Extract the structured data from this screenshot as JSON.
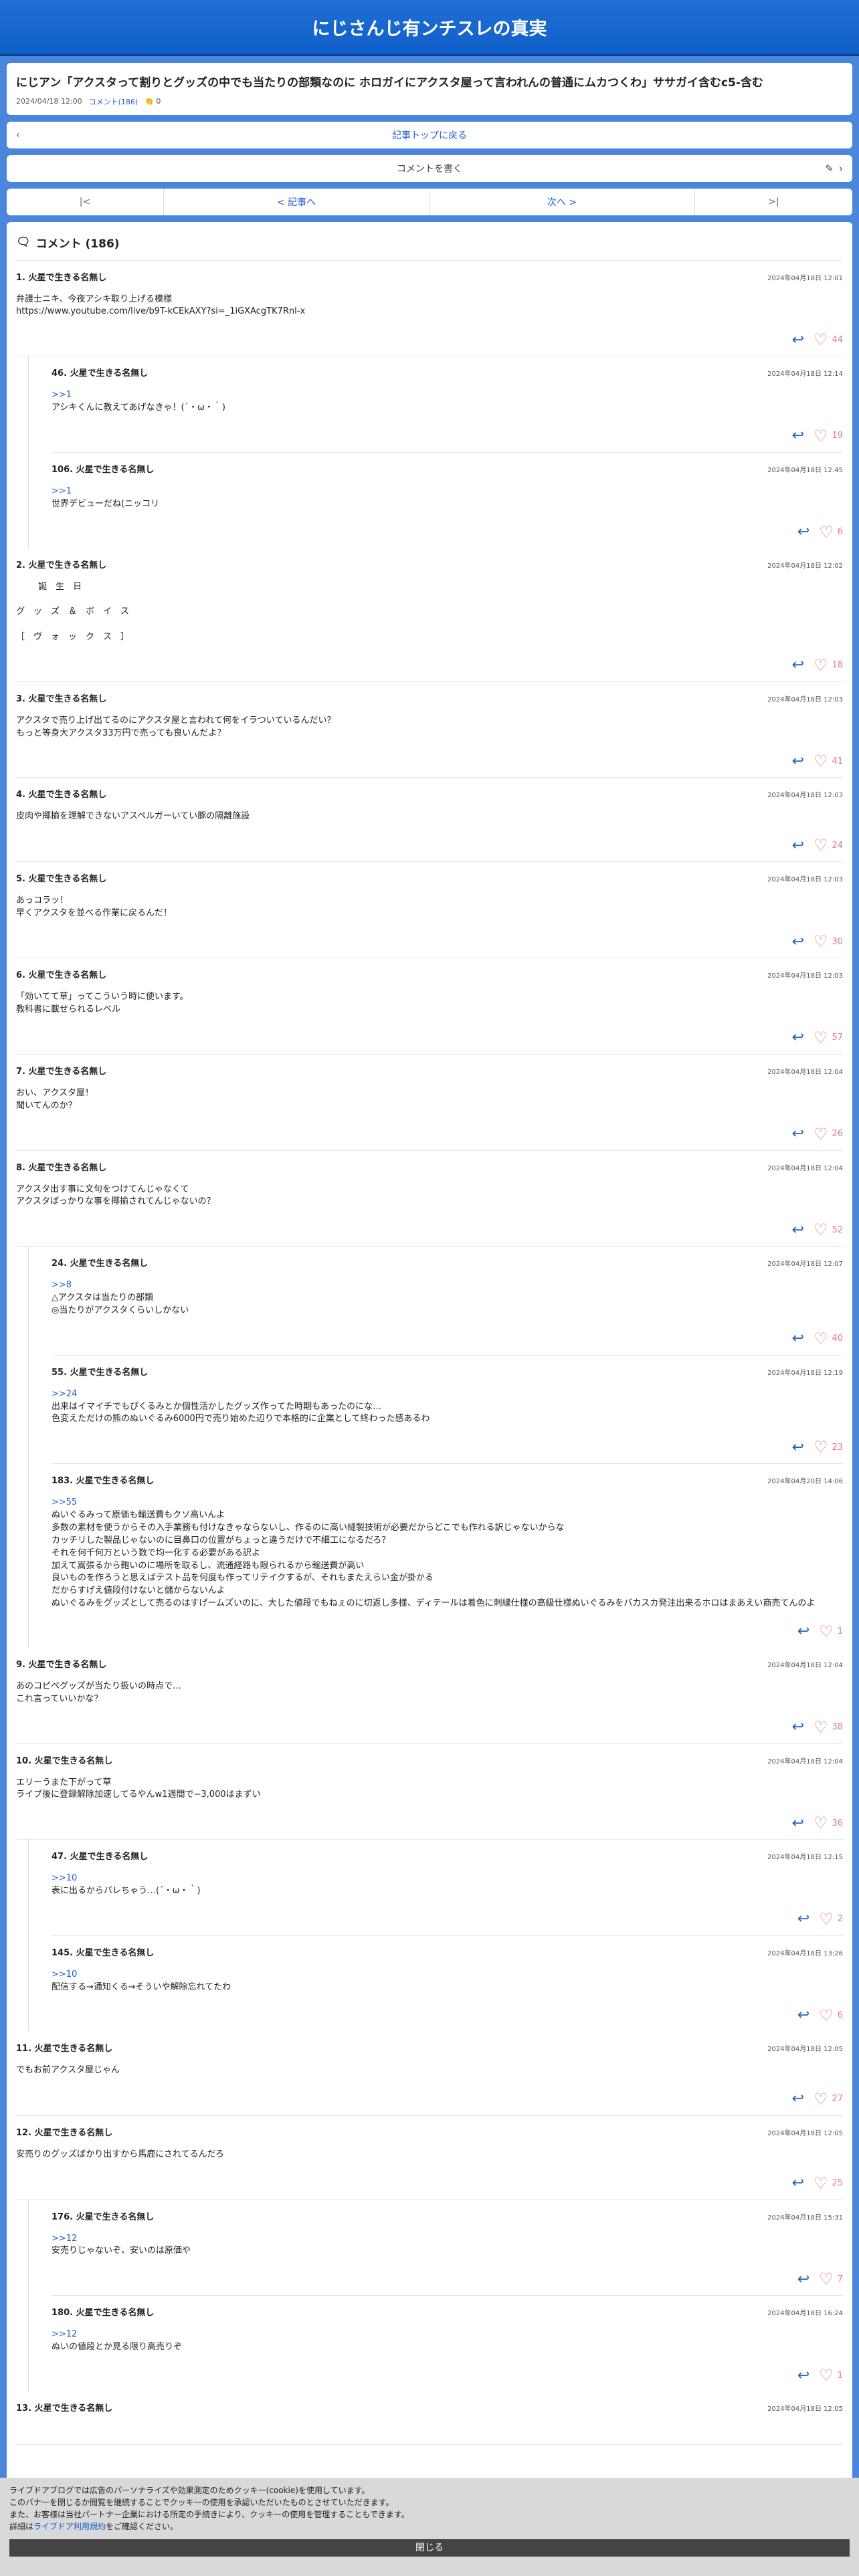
{
  "site": {
    "title": "にじさんじ有ンチスレの真実"
  },
  "article": {
    "title": "にじアン「アクスタって割りとグッズの中でも当たりの部類なのに ホロガイにアクスタ屋って言われんの普通にムカつくわ」ササガイ含むc5-含む",
    "date": "2024/04/18 12:00",
    "comment_link": "コメント(186)",
    "likes": "0"
  },
  "nav": {
    "back_label": "記事トップに戻る",
    "write_label": "コメントを書く",
    "first": "|<",
    "prev": "< 記事へ",
    "next": "次へ >",
    "last": ">|"
  },
  "comments_title": "コメント (186)",
  "comments": [
    {
      "num": "1.",
      "name": "火星で生きる名無し",
      "date": "2024年04月18日 12:01",
      "body": "弁護士ニキ、今夜アシキ取り上げる模様\nhttps://www.youtube.com/live/b9T-kCEkAXY?si=_1iGXAcgTK7Rnl-x",
      "likes": "44",
      "replies": [
        {
          "num": "46.",
          "name": "火星で生きる名無し",
          "date": "2024年04月18日 12:14",
          "anchor": ">>1",
          "body": "アシキくんに教えてあげなきゃ！(´・ω・｀)",
          "likes": "19"
        },
        {
          "num": "106.",
          "name": "火星で生きる名無し",
          "date": "2024年04月18日 12:45",
          "anchor": ">>1",
          "body": "世界デビューだね(ニッコリ",
          "likes": "6"
        }
      ]
    },
    {
      "num": "2.",
      "name": "火星で生きる名無し",
      "date": "2024年04月18日 12:02",
      "body": "        誕　生　日\n\nグ　ッ　ズ　＆　ボ　イ　ス\n\n［　ヴ　ォ　ッ　ク　ス　］",
      "likes": "18",
      "replies": []
    },
    {
      "num": "3.",
      "name": "火星で生きる名無し",
      "date": "2024年04月18日 12:03",
      "body": "アクスタで売り上げ出てるのにアクスタ屋と言われて何をイラついているんだい？\nもっと等身大アクスタ33万円で売っても良いんだよ？",
      "likes": "41",
      "replies": []
    },
    {
      "num": "4.",
      "name": "火星で生きる名無し",
      "date": "2024年04月18日 12:03",
      "body": "皮肉や揶揄を理解できないアスペルガーいてい豚の隔離施設",
      "likes": "24",
      "replies": []
    },
    {
      "num": "5.",
      "name": "火星で生きる名無し",
      "date": "2024年04月18日 12:03",
      "body": "あっコラッ！\n早くアクスタを並べる作業に戻るんだ！",
      "likes": "30",
      "replies": []
    },
    {
      "num": "6.",
      "name": "火星で生きる名無し",
      "date": "2024年04月18日 12:03",
      "body": "「効いてて草」ってこういう時に使います。\n教科書に載せられるレベル",
      "likes": "57",
      "replies": []
    },
    {
      "num": "7.",
      "name": "火星で生きる名無し",
      "date": "2024年04月18日 12:04",
      "body": "おい、アクスタ屋！\n聞いてんのか？",
      "likes": "26",
      "replies": []
    },
    {
      "num": "8.",
      "name": "火星で生きる名無し",
      "date": "2024年04月18日 12:04",
      "body": "アクスタ出す事に文句をつけてんじゃなくて\nアクスタばっかりな事を揶揄されてんじゃないの？",
      "likes": "52",
      "replies": [
        {
          "num": "24.",
          "name": "火星で生きる名無し",
          "date": "2024年04月18日 12:07",
          "anchor": ">>8",
          "body": "△アクスタは当たりの部類\n◎当たりがアクスタくらいしかない",
          "likes": "40"
        },
        {
          "num": "55.",
          "name": "火星で生きる名無し",
          "date": "2024年04月18日 12:19",
          "anchor": ">>24",
          "body": "出来はイマイチでもぴくるみとか個性活かしたグッズ作ってた時期もあったのにな…\n色変えただけの熊のぬいぐるみ6000円で売り始めた辺りで本格的に企業として終わった感あるわ",
          "likes": "23"
        },
        {
          "num": "183.",
          "name": "火星で生きる名無し",
          "date": "2024年04月20日 14:06",
          "anchor": ">>55",
          "body": "ぬいぐるみって原価も輸送費もクソ高いんよ\n多数の素材を使うからその入手業務も付けなきゃならないし、作るのに高い縫製技術が必要だからどこでも作れる訳じゃないからな\nカッチリした製品じゃないのに目鼻口の位置がちょっと違うだけで不細工になるだろ？\nそれを何千何万という数で均一化する必要がある訳よ\n加えて嵩張るから鞄いのに場所を取るし、流通経路も限られるから輸送費が高い\n良いものを作ろうと思えばテスト品を何度も作ってリテイクするが、それもまたえらい金が掛かる\nだからすげえ値段付けないと儲からないんよ\nぬいぐるみをグッズとして売るのはすげームズいのに、大した値段でもねぇのに切返し多様、ディテールは着色に刺繍仕様の高級仕様ぬいぐるみをバカスカ発注出来るホロはまあえい商売てんのよ",
          "likes": "1"
        }
      ]
    },
    {
      "num": "9.",
      "name": "火星で生きる名無し",
      "date": "2024年04月18日 12:04",
      "body": "あのコピペグッズが当たり扱いの時点で…\nこれ言っていいかな？",
      "likes": "38",
      "replies": []
    },
    {
      "num": "10.",
      "name": "火星で生きる名無し",
      "date": "2024年04月18日 12:04",
      "body": "エリーうまた下がって草\nライブ後に登録解除加速してるやんw1週間で−3,000はまずい",
      "likes": "36",
      "replies": [
        {
          "num": "47.",
          "name": "火星で生きる名無し",
          "date": "2024年04月18日 12:15",
          "anchor": ">>10",
          "body": "表に出るからバレちゃう…(´・ω・｀)",
          "likes": "2"
        },
        {
          "num": "145.",
          "name": "火星で生きる名無し",
          "date": "2024年04月18日 13:26",
          "anchor": ">>10",
          "body": "配信する→通知くる→そういや解除忘れてたわ",
          "likes": "6"
        }
      ]
    },
    {
      "num": "11.",
      "name": "火星で生きる名無し",
      "date": "2024年04月18日 12:05",
      "body": "でもお前アクスタ屋じゃん",
      "likes": "27",
      "replies": []
    },
    {
      "num": "12.",
      "name": "火星で生きる名無し",
      "date": "2024年04月18日 12:05",
      "body": "安売りのグッズばかり出すから馬鹿にされてるんだろ",
      "likes": "25",
      "replies": [
        {
          "num": "176.",
          "name": "火星で生きる名無し",
          "date": "2024年04月18日 15:31",
          "anchor": ">>12",
          "body": "安売りじゃないぞ、安いのは原価や",
          "likes": "7"
        },
        {
          "num": "180.",
          "name": "火星で生きる名無し",
          "date": "2024年04月18日 16:24",
          "anchor": ">>12",
          "body": "ぬいの値段とか見る限り高売りぞ",
          "likes": "1"
        }
      ]
    },
    {
      "num": "13.",
      "name": "火星で生きる名無し",
      "date": "2024年04月18日 12:05",
      "body": "",
      "likes": "",
      "replies": []
    }
  ],
  "cookie": {
    "line1": "ライブドアブログでは広告のパーソナライズや効果測定のためクッキー(cookie)を使用しています。",
    "line2": "このバナーを閉じるか閲覧を継続することでクッキーの使用を承認いただいたものとさせていただきます。",
    "line3": "また、お客様は当社パートナー企業における所定の手続きにより、クッキーの使用を管理することもできます。",
    "line4_pre": "詳細は",
    "line4_link": "ライブドア利用規約",
    "line4_post": "をご確認ください。",
    "close": "閉じる"
  }
}
